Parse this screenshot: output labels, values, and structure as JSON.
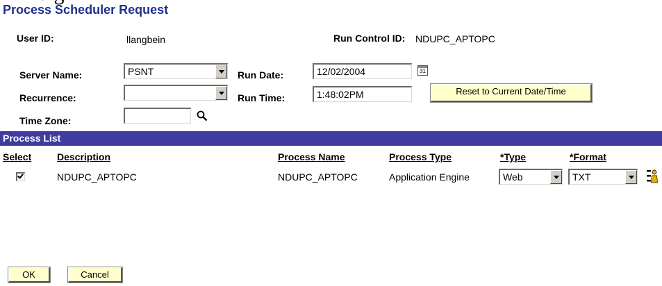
{
  "header": {
    "cropped_text": "nd g",
    "title": "Process Scheduler Request"
  },
  "user": {
    "user_id_label": "User ID:",
    "user_id_value": "llangbein",
    "run_control_label": "Run Control ID:",
    "run_control_value": "NDUPC_APTOPC"
  },
  "form": {
    "server_name_label": "Server Name:",
    "server_name_value": "PSNT",
    "recurrence_label": "Recurrence:",
    "recurrence_value": "",
    "time_zone_label": "Time Zone:",
    "time_zone_value": "",
    "run_date_label": "Run Date:",
    "run_date_value": "12/02/2004",
    "run_time_label": "Run Time:",
    "run_time_value": "1:48:02PM",
    "reset_button": "Reset to Current Date/Time",
    "calendar_icon_text": "31"
  },
  "process_list": {
    "title": "Process List",
    "columns": {
      "select": "Select",
      "description": "Description",
      "process_name": "Process Name",
      "process_type": "Process Type",
      "type": "*Type",
      "format": "*Format"
    },
    "rows": [
      {
        "selected": true,
        "description": "NDUPC_APTOPC",
        "process_name": "NDUPC_APTOPC",
        "process_type": "Application Engine",
        "type": "Web",
        "format": "TXT"
      }
    ]
  },
  "footer": {
    "ok_button": "OK",
    "cancel_button": "Cancel"
  },
  "colors": {
    "title": "#1f2f8e",
    "bar": "#3f3ba0",
    "button_bg": "#ffffcc"
  }
}
